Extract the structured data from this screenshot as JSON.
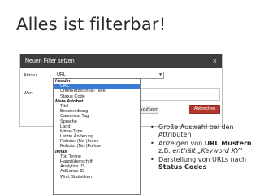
{
  "slide": {
    "title": "Alles ist filterbar!"
  },
  "dialog": {
    "title": "Neuen Filter setzen",
    "close_glyph": "×",
    "attribute_label": "Attribut",
    "value_label": "Wert",
    "selected_attribute": "URL",
    "add_button": "hinzufügen",
    "cancel_button": "Abbrechen"
  },
  "dropdown": {
    "items": [
      {
        "label": "Header",
        "group": true
      },
      {
        "label": "URL",
        "group": false,
        "selected": true
      },
      {
        "label": "Unterverzeichnis-Tiefe",
        "group": false
      },
      {
        "label": "Status Code",
        "group": false
      },
      {
        "label": "Meta Attribut",
        "group": true
      },
      {
        "label": "Titel",
        "group": false
      },
      {
        "label": "Beschreibung",
        "group": false
      },
      {
        "label": "Canonical Tag",
        "group": false
      },
      {
        "label": "Sprache",
        "group": false
      },
      {
        "label": "Land",
        "group": false
      },
      {
        "label": "Mime-Type",
        "group": false
      },
      {
        "label": "Letzte Änderung",
        "group": false
      },
      {
        "label": "Robots: (No-)Index",
        "group": false
      },
      {
        "label": "Robots: (No-)Follow",
        "group": false
      },
      {
        "label": "Inhalt",
        "group": true
      },
      {
        "label": "Top Terme",
        "group": false
      },
      {
        "label": "Hauptüberschrift",
        "group": false
      },
      {
        "label": "Analytics ID",
        "group": false
      },
      {
        "label": "AdSense-ID",
        "group": false
      },
      {
        "label": "Wort Statistiken",
        "group": false
      }
    ]
  },
  "bullets": {
    "b1_text": "Große Auswahl bei den Attributen",
    "b2_pre": "Anzeigen von ",
    "b2_bold": "URL Mustern",
    "b2_mid": " z.B. ",
    "b2_italic": "enthält „Keyword XY\"",
    "b3_pre": "Darstellung von URLs nach ",
    "b3_bold": "Status Codes"
  }
}
